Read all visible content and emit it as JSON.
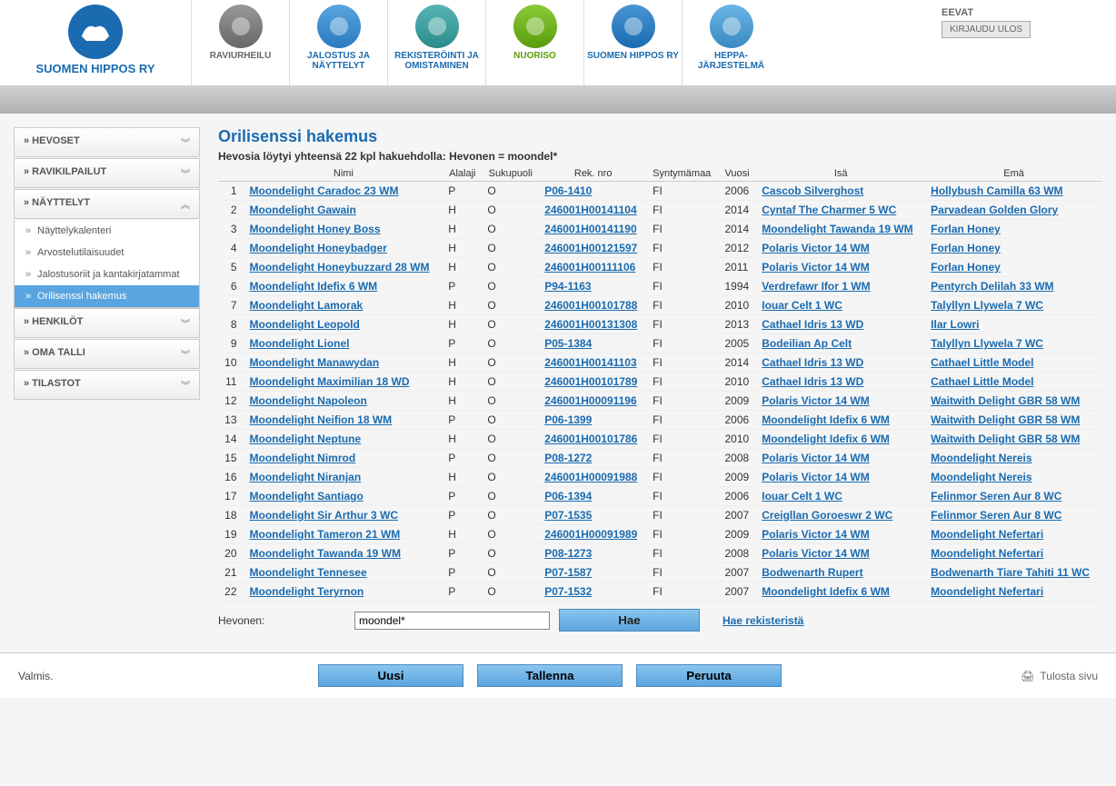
{
  "header": {
    "logo_text": "SUOMEN HIPPOS RY",
    "nav": [
      {
        "label": "RAVIURHEILU",
        "color": "c-gray"
      },
      {
        "label": "JALOSTUS JA NÄYTTELYT",
        "color": "c-blue"
      },
      {
        "label": "REKISTERÖINTI JA OMISTAMINEN",
        "color": "c-teal"
      },
      {
        "label": "NUORISO",
        "color": "c-green"
      },
      {
        "label": "SUOMEN HIPPOS RY",
        "color": "c-hippos"
      },
      {
        "label": "HEPPA-JÄRJESTELMÄ",
        "color": "c-heppa"
      }
    ],
    "user": "EEVAT",
    "logout": "KIRJAUDU ULOS"
  },
  "sidebar": {
    "items": [
      {
        "label": "HEVOSET",
        "expanded": false
      },
      {
        "label": "RAVIKILPAILUT",
        "expanded": false
      },
      {
        "label": "NÄYTTELYT",
        "expanded": true,
        "children": [
          {
            "label": "Näyttelykalenteri",
            "active": false
          },
          {
            "label": "Arvostelutilaisuudet",
            "active": false
          },
          {
            "label": "Jalostusoriit ja kantakirjatammat",
            "active": false
          },
          {
            "label": "Orilisenssi hakemus",
            "active": true
          }
        ]
      },
      {
        "label": "HENKILÖT",
        "expanded": false
      },
      {
        "label": "OMA TALLI",
        "expanded": false
      },
      {
        "label": "TILASTOT",
        "expanded": false
      }
    ]
  },
  "content": {
    "title": "Orilisenssi hakemus",
    "result_info": "Hevosia löytyi yhteensä 22 kpl hakuehdolla: Hevonen = moondel*",
    "columns": [
      "",
      "Nimi",
      "Alalaji",
      "Sukupuoli",
      "Rek. nro",
      "Syntymämaa",
      "Vuosi",
      "Isä",
      "Emä"
    ],
    "rows": [
      {
        "n": 1,
        "nimi": "Moondelight Caradoc 23 WM",
        "alalaji": "P",
        "suku": "O",
        "rek": "P06-1410",
        "maa": "FI",
        "vuosi": "2006",
        "isa": "Cascob Silverghost",
        "ema": "Hollybush Camilla 63 WM"
      },
      {
        "n": 2,
        "nimi": "Moondelight Gawain",
        "alalaji": "H",
        "suku": "O",
        "rek": "246001H00141104",
        "maa": "FI",
        "vuosi": "2014",
        "isa": "Cyntaf The Charmer 5 WC",
        "ema": "Parvadean Golden Glory"
      },
      {
        "n": 3,
        "nimi": "Moondelight Honey Boss",
        "alalaji": "H",
        "suku": "O",
        "rek": "246001H00141190",
        "maa": "FI",
        "vuosi": "2014",
        "isa": "Moondelight Tawanda 19 WM",
        "ema": "Forlan Honey"
      },
      {
        "n": 4,
        "nimi": "Moondelight Honeybadger",
        "alalaji": "H",
        "suku": "O",
        "rek": "246001H00121597",
        "maa": "FI",
        "vuosi": "2012",
        "isa": "Polaris Victor 14 WM",
        "ema": "Forlan Honey"
      },
      {
        "n": 5,
        "nimi": "Moondelight Honeybuzzard 28 WM",
        "alalaji": "H",
        "suku": "O",
        "rek": "246001H00111106",
        "maa": "FI",
        "vuosi": "2011",
        "isa": "Polaris Victor 14 WM",
        "ema": "Forlan Honey"
      },
      {
        "n": 6,
        "nimi": "Moondelight Idefix 6 WM",
        "alalaji": "P",
        "suku": "O",
        "rek": "P94-1163",
        "maa": "FI",
        "vuosi": "1994",
        "isa": "Verdrefawr Ifor 1 WM",
        "ema": "Pentyrch Delilah 33 WM"
      },
      {
        "n": 7,
        "nimi": "Moondelight Lamorak",
        "alalaji": "H",
        "suku": "O",
        "rek": "246001H00101788",
        "maa": "FI",
        "vuosi": "2010",
        "isa": "Iouar Celt 1 WC",
        "ema": "Talyllyn Llywela 7 WC"
      },
      {
        "n": 8,
        "nimi": "Moondelight Leopold",
        "alalaji": "H",
        "suku": "O",
        "rek": "246001H00131308",
        "maa": "FI",
        "vuosi": "2013",
        "isa": "Cathael Idris 13 WD",
        "ema": "Ilar Lowri"
      },
      {
        "n": 9,
        "nimi": "Moondelight Lionel",
        "alalaji": "P",
        "suku": "O",
        "rek": "P05-1384",
        "maa": "FI",
        "vuosi": "2005",
        "isa": "Bodeilian Ap Celt",
        "ema": "Talyllyn Llywela 7 WC"
      },
      {
        "n": 10,
        "nimi": "Moondelight Manawydan",
        "alalaji": "H",
        "suku": "O",
        "rek": "246001H00141103",
        "maa": "FI",
        "vuosi": "2014",
        "isa": "Cathael Idris 13 WD",
        "ema": "Cathael Little Model"
      },
      {
        "n": 11,
        "nimi": "Moondelight Maximilian 18 WD",
        "alalaji": "H",
        "suku": "O",
        "rek": "246001H00101789",
        "maa": "FI",
        "vuosi": "2010",
        "isa": "Cathael Idris 13 WD",
        "ema": "Cathael Little Model"
      },
      {
        "n": 12,
        "nimi": "Moondelight Napoleon",
        "alalaji": "H",
        "suku": "O",
        "rek": "246001H00091196",
        "maa": "FI",
        "vuosi": "2009",
        "isa": "Polaris Victor 14 WM",
        "ema": "Waitwith Delight GBR 58 WM"
      },
      {
        "n": 13,
        "nimi": "Moondelight Neifion 18 WM",
        "alalaji": "P",
        "suku": "O",
        "rek": "P06-1399",
        "maa": "FI",
        "vuosi": "2006",
        "isa": "Moondelight Idefix 6 WM",
        "ema": "Waitwith Delight GBR 58 WM"
      },
      {
        "n": 14,
        "nimi": "Moondelight Neptune",
        "alalaji": "H",
        "suku": "O",
        "rek": "246001H00101786",
        "maa": "FI",
        "vuosi": "2010",
        "isa": "Moondelight Idefix 6 WM",
        "ema": "Waitwith Delight GBR 58 WM"
      },
      {
        "n": 15,
        "nimi": "Moondelight Nimrod",
        "alalaji": "P",
        "suku": "O",
        "rek": "P08-1272",
        "maa": "FI",
        "vuosi": "2008",
        "isa": "Polaris Victor 14 WM",
        "ema": "Moondelight Nereis"
      },
      {
        "n": 16,
        "nimi": "Moondelight Niranjan",
        "alalaji": "H",
        "suku": "O",
        "rek": "246001H00091988",
        "maa": "FI",
        "vuosi": "2009",
        "isa": "Polaris Victor 14 WM",
        "ema": "Moondelight Nereis"
      },
      {
        "n": 17,
        "nimi": "Moondelight Santiago",
        "alalaji": "P",
        "suku": "O",
        "rek": "P06-1394",
        "maa": "FI",
        "vuosi": "2006",
        "isa": "Iouar Celt 1 WC",
        "ema": "Felinmor Seren Aur 8 WC"
      },
      {
        "n": 18,
        "nimi": "Moondelight Sir Arthur 3 WC",
        "alalaji": "P",
        "suku": "O",
        "rek": "P07-1535",
        "maa": "FI",
        "vuosi": "2007",
        "isa": "Creigllan Goroeswr 2 WC",
        "ema": "Felinmor Seren Aur 8 WC"
      },
      {
        "n": 19,
        "nimi": "Moondelight Tameron 21 WM",
        "alalaji": "H",
        "suku": "O",
        "rek": "246001H00091989",
        "maa": "FI",
        "vuosi": "2009",
        "isa": "Polaris Victor 14 WM",
        "ema": "Moondelight Nefertari"
      },
      {
        "n": 20,
        "nimi": "Moondelight Tawanda 19 WM",
        "alalaji": "P",
        "suku": "O",
        "rek": "P08-1273",
        "maa": "FI",
        "vuosi": "2008",
        "isa": "Polaris Victor 14 WM",
        "ema": "Moondelight Nefertari"
      },
      {
        "n": 21,
        "nimi": "Moondelight Tennesee",
        "alalaji": "P",
        "suku": "O",
        "rek": "P07-1587",
        "maa": "FI",
        "vuosi": "2007",
        "isa": "Bodwenarth Rupert",
        "ema": "Bodwenarth Tiare Tahiti 11 WC"
      },
      {
        "n": 22,
        "nimi": "Moondelight Teryrnon",
        "alalaji": "P",
        "suku": "O",
        "rek": "P07-1532",
        "maa": "FI",
        "vuosi": "2007",
        "isa": "Moondelight Idefix 6 WM",
        "ema": "Moondelight Nefertari"
      }
    ],
    "search": {
      "label": "Hevonen:",
      "value": "moondel*",
      "button": "Hae",
      "reg_link": "Hae rekisteristä"
    }
  },
  "footer": {
    "status": "Valmis.",
    "buttons": [
      "Uusi",
      "Tallenna",
      "Peruuta"
    ],
    "print": "Tulosta sivu"
  }
}
